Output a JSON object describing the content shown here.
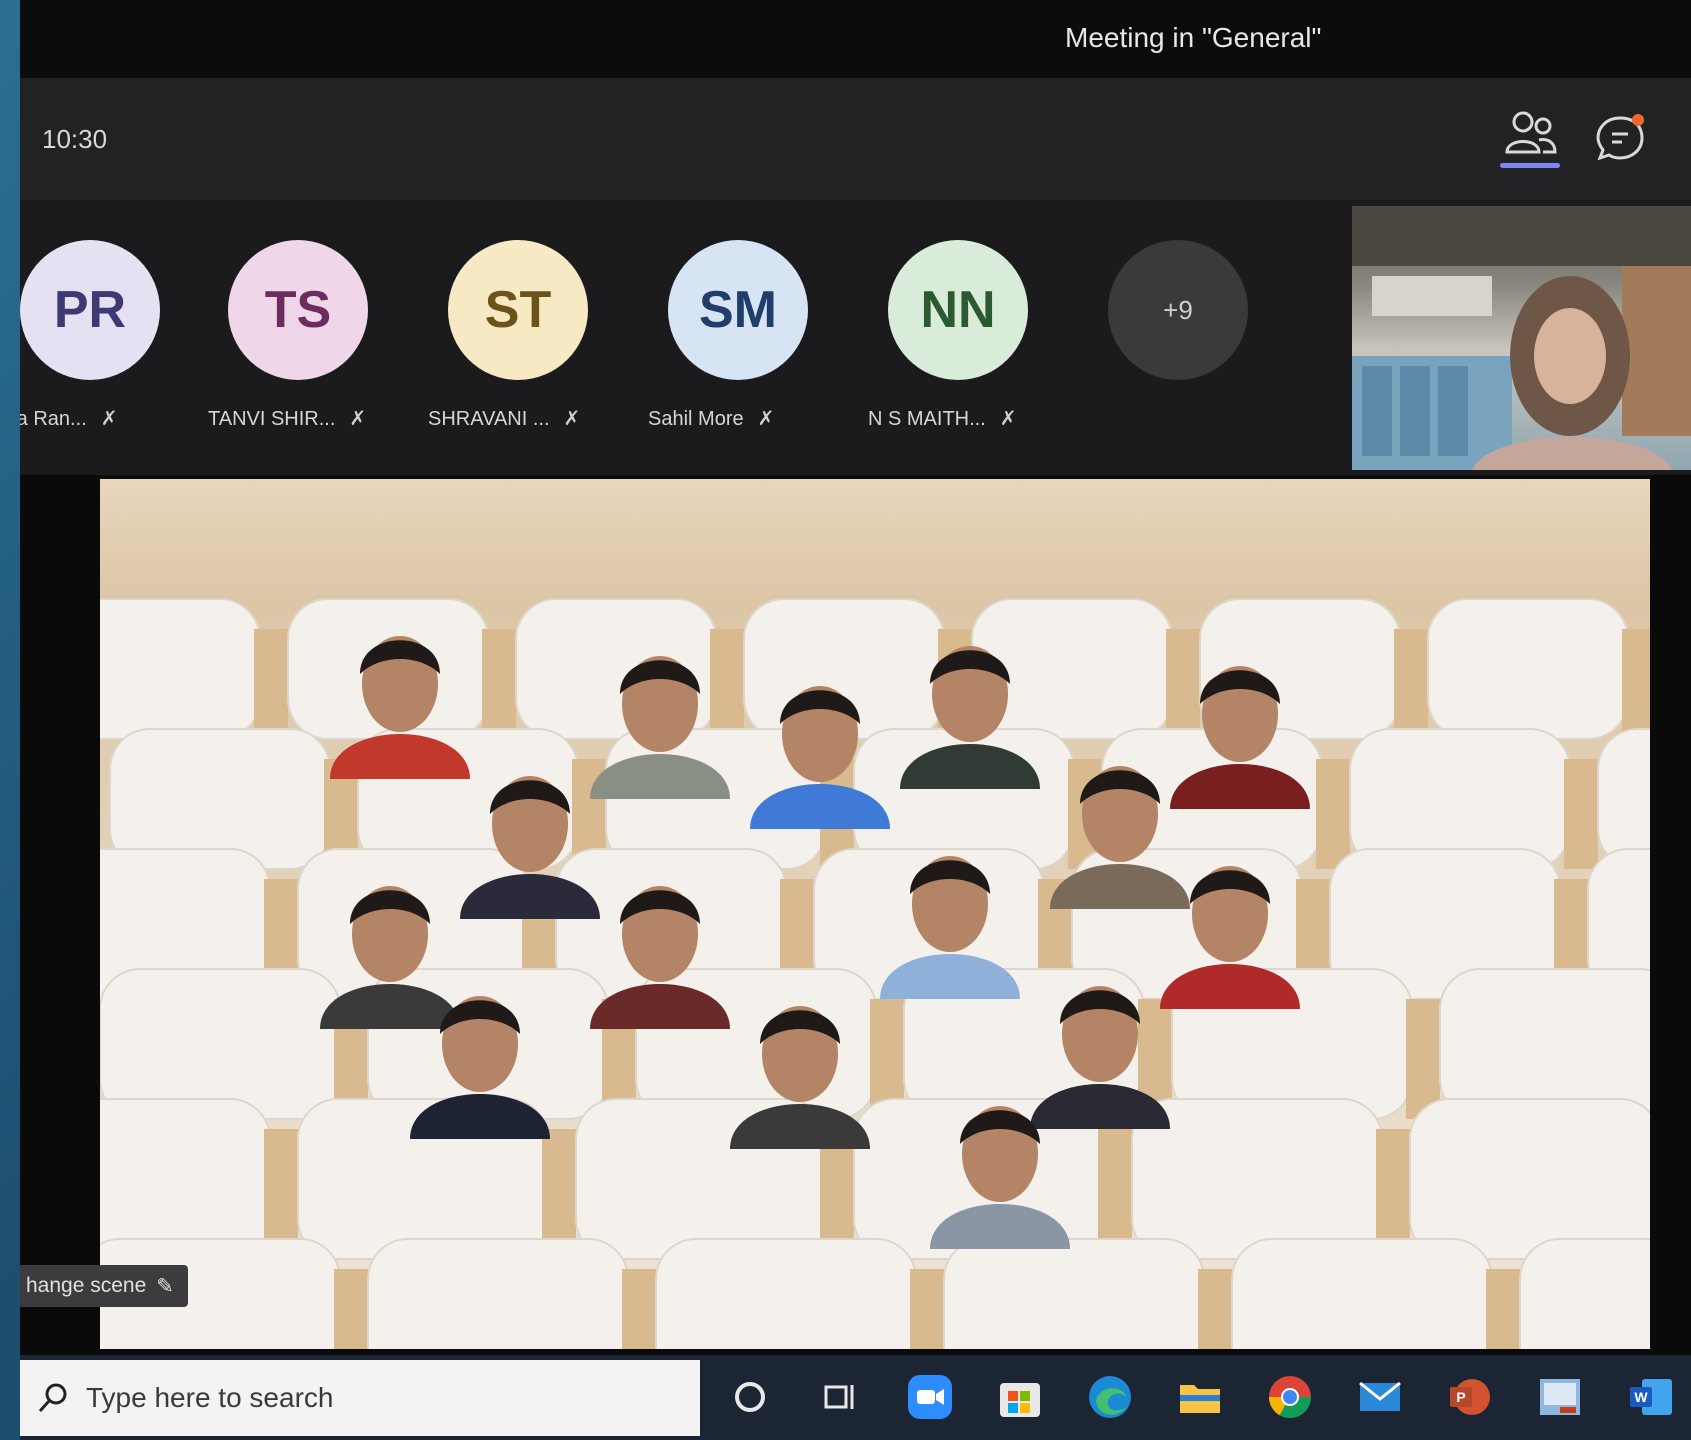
{
  "window": {
    "title": "Meeting in \"General\""
  },
  "toolbar": {
    "time": "10:30"
  },
  "participants": [
    {
      "initials": "PR",
      "name": "rva Ran...",
      "bg": "#e6e1f2",
      "fg": "#3d3a73"
    },
    {
      "initials": "TS",
      "name": "TANVI SHIR...",
      "bg": "#efd6e8",
      "fg": "#6a2d5e"
    },
    {
      "initials": "ST",
      "name": "SHRAVANI ...",
      "bg": "#f6e9c3",
      "fg": "#6b531a"
    },
    {
      "initials": "SM",
      "name": "Sahil More",
      "bg": "#d6e4f3",
      "fg": "#213d6b"
    },
    {
      "initials": "NN",
      "name": "N S MAITH...",
      "bg": "#d8ecd9",
      "fg": "#2b5a31"
    }
  ],
  "overflow": {
    "label": "+9"
  },
  "stage": {
    "change_scene_label": "hange scene"
  },
  "taskbar": {
    "search_placeholder": "Type here to search",
    "icons": [
      "cortana-icon",
      "task-view-icon",
      "zoom-icon",
      "store-icon",
      "edge-icon",
      "file-explorer-icon",
      "chrome-icon",
      "mail-icon",
      "powerpoint-icon",
      "photo-app-icon",
      "word-icon"
    ]
  }
}
